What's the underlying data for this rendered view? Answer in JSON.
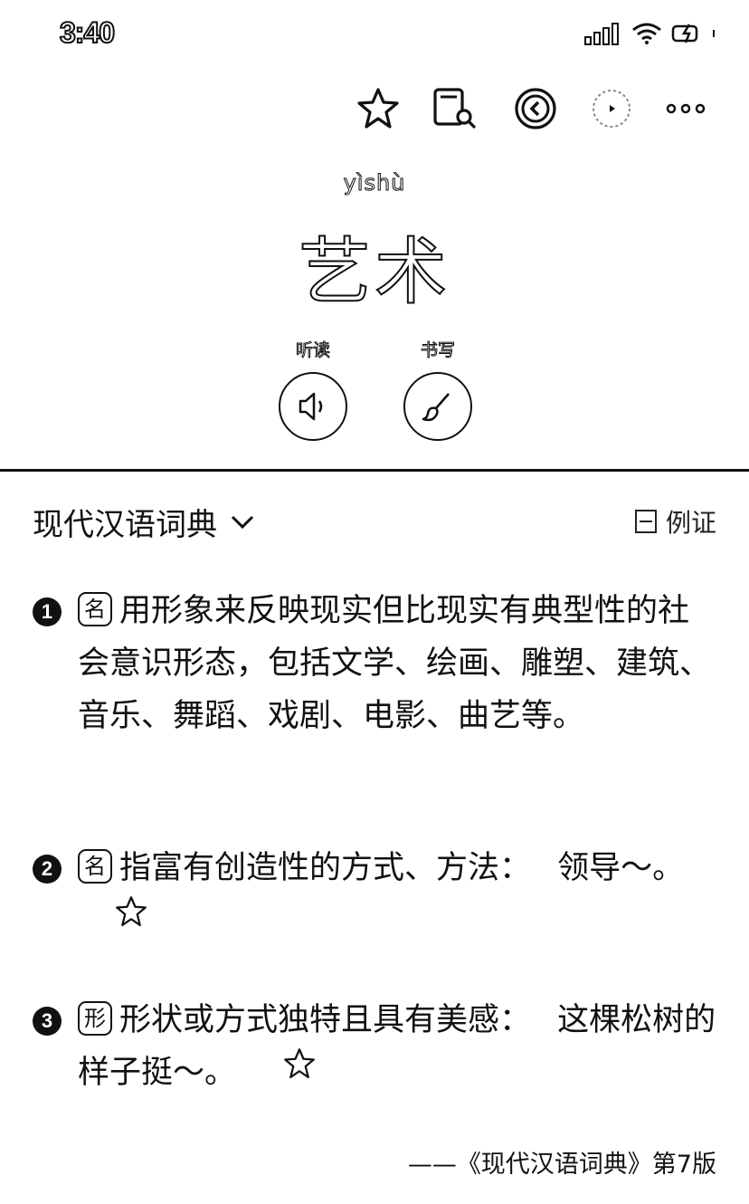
{
  "status": {
    "time": "3:40"
  },
  "headword": {
    "pinyin": "yìshù",
    "word": "艺术"
  },
  "actions": {
    "listen_label": "听读",
    "write_label": "书写"
  },
  "dictionary": {
    "name": "现代汉语词典",
    "example_label": "例证"
  },
  "definitions": [
    {
      "num": "1",
      "pos": "名",
      "text": "用形象来反映现实但比现实有典型性的社会意识形态，包括文学、绘画、雕塑、建筑、音乐、舞蹈、戏剧、电影、曲艺等。",
      "example": ""
    },
    {
      "num": "2",
      "pos": "名",
      "text": "指富有创造性的方式、方法：",
      "example": "领导～。"
    },
    {
      "num": "3",
      "pos": "形",
      "text": "形状或方式独特且具有美感：",
      "example": "这棵松树的样子挺～。"
    }
  ],
  "source": "——《现代汉语词典》第7版",
  "icons": [
    "signal-icon",
    "wifi-icon",
    "battery-icon",
    "star-icon",
    "search-book-icon",
    "back-icon",
    "play-icon",
    "more-icon",
    "speaker-icon",
    "brush-icon",
    "chevron-down-icon"
  ]
}
